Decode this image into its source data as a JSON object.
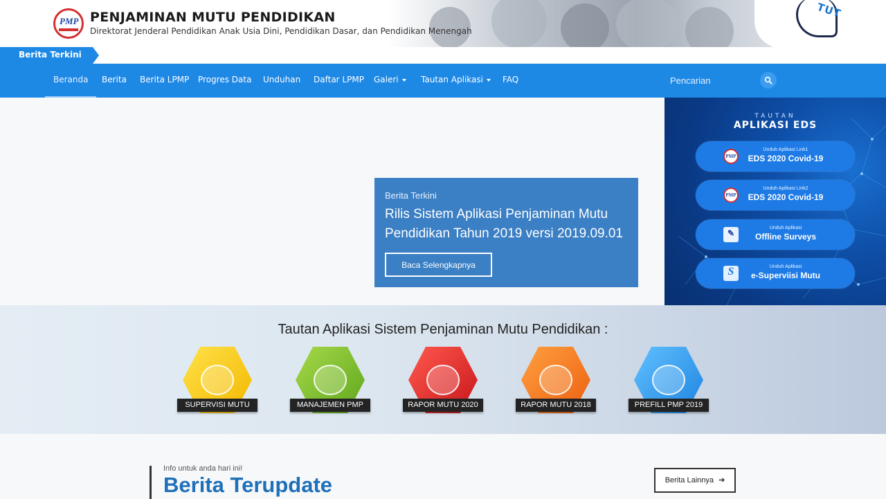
{
  "header": {
    "logo_text": "PMP",
    "title": "PENJAMINAN MUTU PENDIDIKAN",
    "subtitle": "Direktorat Jenderal Pendidikan Anak Usia Dini, Pendidikan Dasar, dan Pendidikan Menengah",
    "banner_text": "TUT"
  },
  "ticker": {
    "label": "Berita Terkini"
  },
  "nav": {
    "items": [
      {
        "label": "Beranda"
      },
      {
        "label": "Berita"
      },
      {
        "label": "Berita LPMP"
      },
      {
        "label": "Progres Data"
      },
      {
        "label": "Unduhan"
      },
      {
        "label": "Daftar LPMP"
      },
      {
        "label": "Galeri"
      },
      {
        "label": "Tautan Aplikasi"
      },
      {
        "label": "FAQ"
      }
    ],
    "active": "Beranda",
    "search_placeholder": "Pencarian"
  },
  "hero": {
    "tag": "Berita Terkini",
    "title": "Rilis Sistem Aplikasi Penjaminan Mutu Pendidikan Tahun 2019 versi 2019.09.01",
    "button": "Baca Selengkapnya"
  },
  "sidebar": {
    "kicker": "TAUTAN",
    "heading": "APLIKASI EDS",
    "links": [
      {
        "small": "Unduh Aplikasi Link1",
        "main": "EDS 2020 Covid-19",
        "icon": "PMP"
      },
      {
        "small": "Unduh Aplikasi Link2",
        "main": "EDS 2020 Covid-19",
        "icon": "PMP"
      },
      {
        "small": "Unduh Aplikasi",
        "main": "Offline Surveys",
        "icon": "✎"
      },
      {
        "small": "Unduh Aplikasi",
        "main": "e-Superviisi Mutu",
        "icon": "S"
      }
    ]
  },
  "apps": {
    "title": "Tautan Aplikasi Sistem Penjaminan Mutu Pendidikan :",
    "items": [
      {
        "label": "SUPERVISI MUTU",
        "color": "#f7c600"
      },
      {
        "label": "MANAJEMEN PMP",
        "color": "#7cc128"
      },
      {
        "label": "RAPOR MUTU 2020",
        "color": "#e0262b"
      },
      {
        "label": "RAPOR MUTU 2018",
        "color": "#f47c1a"
      },
      {
        "label": "PREFILL PMP 2019",
        "color": "#2c9bf0"
      }
    ]
  },
  "news": {
    "kicker": "Info untuk anda hari ini!",
    "title": "Berita Terupdate",
    "more": "Berita Lainnya",
    "more_arrow": "➔"
  }
}
